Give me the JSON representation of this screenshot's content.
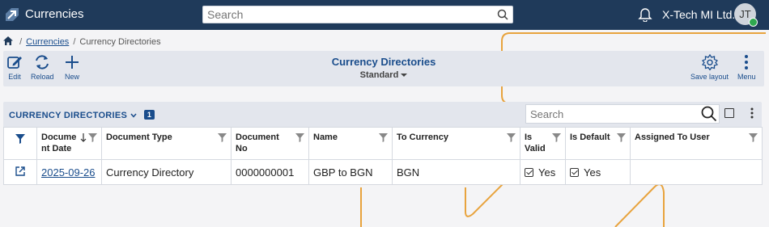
{
  "app": {
    "title": "Currencies",
    "company": "X-Tech MI Ltd.",
    "user_initials": "JT"
  },
  "search": {
    "placeholder": "Search"
  },
  "breadcrumb": {
    "parent": "Currencies",
    "sep": "/",
    "current": "Currency Directories"
  },
  "toolbar": {
    "edit_label": "Edit",
    "reload_label": "Reload",
    "new_label": "New",
    "title": "Currency Directories",
    "layout": "Standard",
    "save_layout_label": "Save layout",
    "menu_label": "Menu"
  },
  "grid": {
    "title": "CURRENCY DIRECTORIES",
    "count": "1",
    "search_placeholder": "Search",
    "columns": {
      "document_date": "Document Date",
      "document_type": "Document Type",
      "document_no": "Document No",
      "name": "Name",
      "to_currency": "To Currency",
      "is_valid": "Is Valid",
      "is_default": "Is Default",
      "assigned_to_user": "Assigned To User"
    },
    "rows": [
      {
        "document_date": "2025-09-26",
        "document_type": "Currency Directory",
        "document_no": "0000000001",
        "name": "GBP to BGN",
        "to_currency": "BGN",
        "is_valid": "Yes",
        "is_default": "Yes",
        "assigned_to_user": ""
      }
    ]
  },
  "colors": {
    "header_bg": "#1f3a5a",
    "accent": "#1a4d8c",
    "panel_bg": "#e3e6ed",
    "decor_orange": "#e8a33d",
    "status_online": "#2fa84f"
  }
}
